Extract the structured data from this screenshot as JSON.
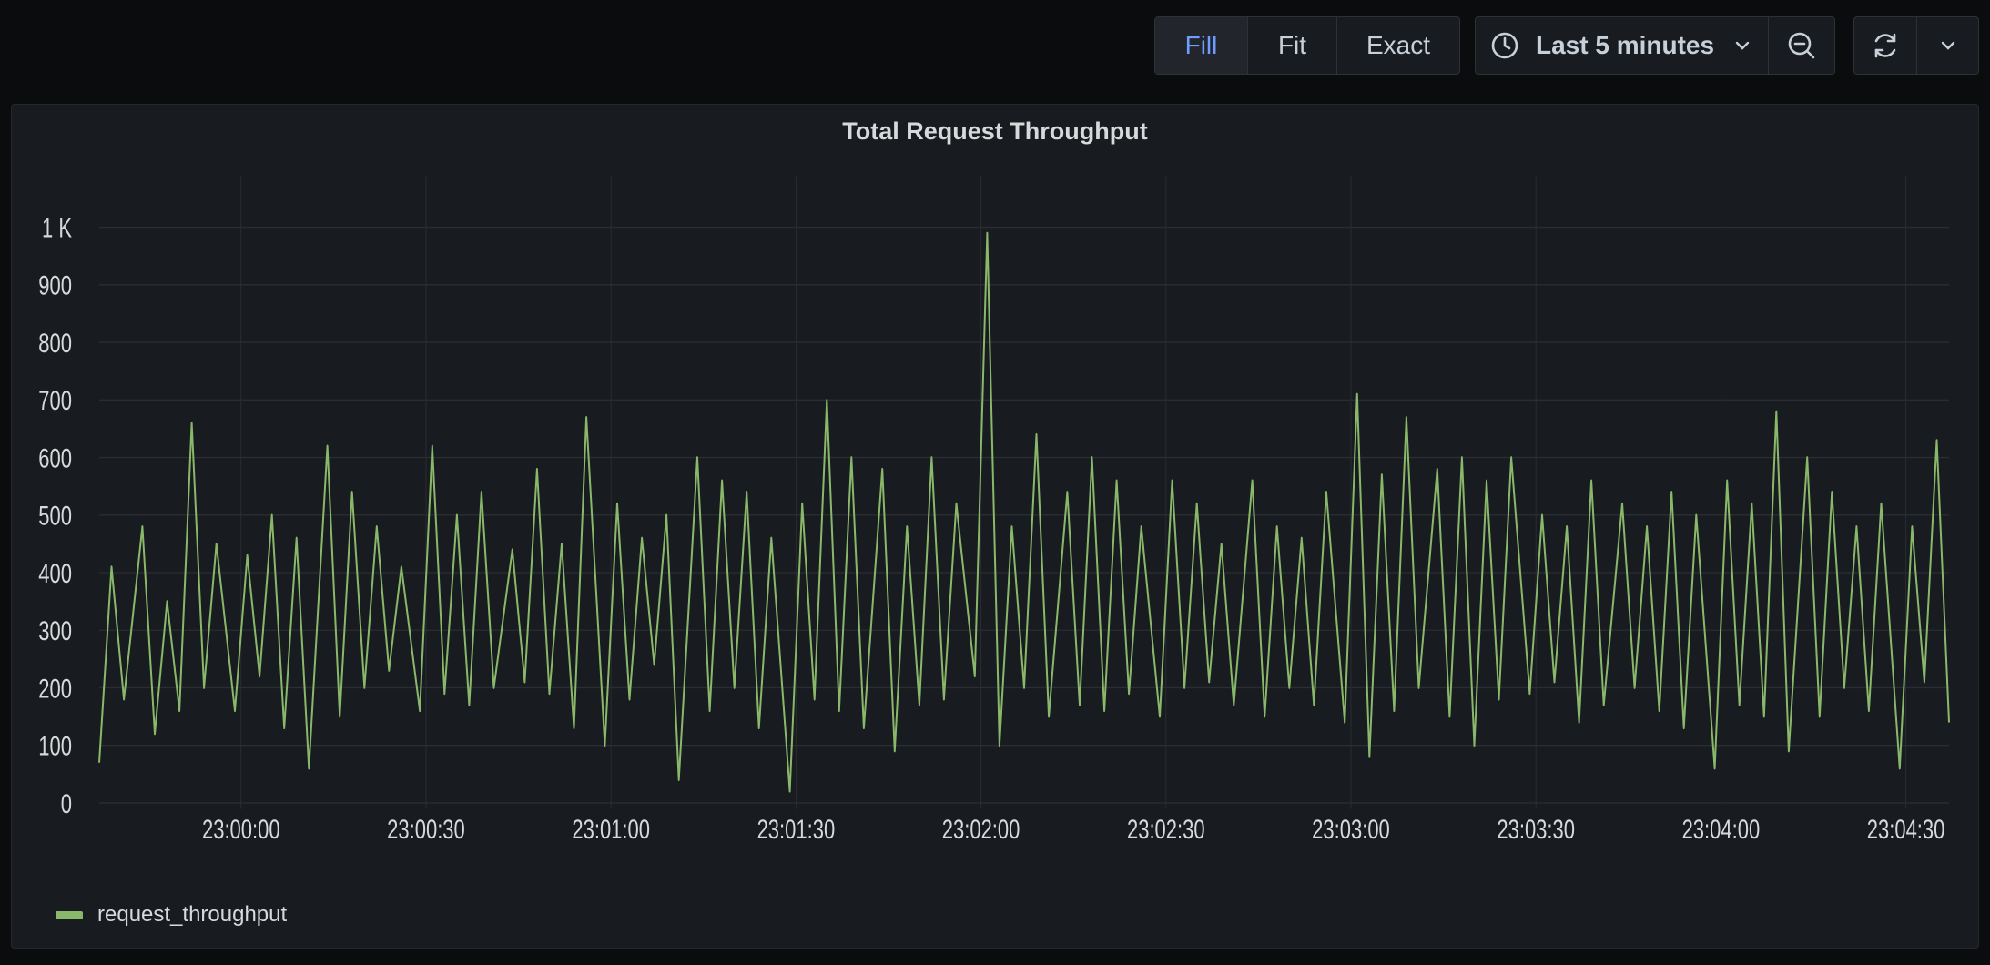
{
  "toolbar": {
    "zoom_modes": [
      {
        "label": "Fill",
        "active": true
      },
      {
        "label": "Fit",
        "active": false
      },
      {
        "label": "Exact",
        "active": false
      }
    ],
    "time_range": {
      "label": "Last 5 minutes",
      "icon": "clock-icon",
      "dropdown_icon": "chevron-down-icon"
    },
    "zoom_out_icon": "zoom-out-icon",
    "refresh_icon": "refresh-icon",
    "refresh_dropdown_icon": "chevron-down-icon"
  },
  "colors": {
    "background": "#0b0c0e",
    "panel": "#181b1f",
    "accent": "#6e9fff",
    "series": "#8ab86a",
    "grid": "#2a2d31",
    "text": "#d8d9da"
  },
  "panel": {
    "title": "Total Request Throughput"
  },
  "chart_data": {
    "type": "line",
    "title": "Total Request Throughput",
    "xlabel": "",
    "ylabel": "",
    "x_range": [
      "22:59:37",
      "23:04:37"
    ],
    "ylim": [
      0,
      1000
    ],
    "y_ticks": [
      "0",
      "100",
      "200",
      "300",
      "400",
      "500",
      "600",
      "700",
      "800",
      "900",
      "1 K"
    ],
    "x_ticks": [
      "23:00:00",
      "23:00:30",
      "23:01:00",
      "23:01:30",
      "23:02:00",
      "23:02:30",
      "23:03:00",
      "23:03:30",
      "23:04:00",
      "23:04:30"
    ],
    "grid": true,
    "legend": "bottom-left",
    "series": [
      {
        "name": "request_throughput",
        "color": "#8ab86a",
        "x": [
          "22:59:37",
          "22:59:39",
          "22:59:41",
          "22:59:44",
          "22:59:46",
          "22:59:48",
          "22:59:50",
          "22:59:52",
          "22:59:54",
          "22:59:56",
          "22:59:59",
          "23:00:01",
          "23:00:03",
          "23:00:05",
          "23:00:07",
          "23:00:09",
          "23:00:11",
          "23:00:14",
          "23:00:16",
          "23:00:18",
          "23:00:20",
          "23:00:22",
          "23:00:24",
          "23:00:26",
          "23:00:29",
          "23:00:31",
          "23:00:33",
          "23:00:35",
          "23:00:37",
          "23:00:39",
          "23:00:41",
          "23:00:44",
          "23:00:46",
          "23:00:48",
          "23:00:50",
          "23:00:52",
          "23:00:54",
          "23:00:56",
          "23:00:59",
          "23:01:01",
          "23:01:03",
          "23:01:05",
          "23:01:07",
          "23:01:09",
          "23:01:11",
          "23:01:14",
          "23:01:16",
          "23:01:18",
          "23:01:20",
          "23:01:22",
          "23:01:24",
          "23:01:26",
          "23:01:29",
          "23:01:31",
          "23:01:33",
          "23:01:35",
          "23:01:37",
          "23:01:39",
          "23:01:41",
          "23:01:44",
          "23:01:46",
          "23:01:48",
          "23:01:50",
          "23:01:52",
          "23:01:54",
          "23:01:56",
          "23:01:59",
          "23:02:01",
          "23:02:03",
          "23:02:05",
          "23:02:07",
          "23:02:09",
          "23:02:11",
          "23:02:14",
          "23:02:16",
          "23:02:18",
          "23:02:20",
          "23:02:22",
          "23:02:24",
          "23:02:26",
          "23:02:29",
          "23:02:31",
          "23:02:33",
          "23:02:35",
          "23:02:37",
          "23:02:39",
          "23:02:41",
          "23:02:44",
          "23:02:46",
          "23:02:48",
          "23:02:50",
          "23:02:52",
          "23:02:54",
          "23:02:56",
          "23:02:59",
          "23:03:01",
          "23:03:03",
          "23:03:05",
          "23:03:07",
          "23:03:09",
          "23:03:11",
          "23:03:14",
          "23:03:16",
          "23:03:18",
          "23:03:20",
          "23:03:22",
          "23:03:24",
          "23:03:26",
          "23:03:29",
          "23:03:31",
          "23:03:33",
          "23:03:35",
          "23:03:37",
          "23:03:39",
          "23:03:41",
          "23:03:44",
          "23:03:46",
          "23:03:48",
          "23:03:50",
          "23:03:52",
          "23:03:54",
          "23:03:56",
          "23:03:59",
          "23:04:01",
          "23:04:03",
          "23:04:05",
          "23:04:07",
          "23:04:09",
          "23:04:11",
          "23:04:14",
          "23:04:16",
          "23:04:18",
          "23:04:20",
          "23:04:22",
          "23:04:24",
          "23:04:26",
          "23:04:29",
          "23:04:31",
          "23:04:33",
          "23:04:35",
          "23:04:37"
        ],
        "values": [
          70,
          410,
          180,
          480,
          120,
          350,
          160,
          660,
          200,
          450,
          160,
          430,
          220,
          500,
          130,
          460,
          60,
          620,
          150,
          540,
          200,
          480,
          230,
          410,
          160,
          620,
          190,
          500,
          170,
          540,
          200,
          440,
          210,
          580,
          190,
          450,
          130,
          670,
          100,
          520,
          180,
          460,
          240,
          500,
          40,
          600,
          160,
          560,
          200,
          540,
          130,
          460,
          20,
          520,
          180,
          700,
          160,
          600,
          130,
          580,
          90,
          480,
          170,
          600,
          180,
          520,
          220,
          990,
          100,
          480,
          200,
          640,
          150,
          540,
          170,
          600,
          160,
          560,
          190,
          480,
          150,
          560,
          200,
          520,
          210,
          450,
          170,
          560,
          150,
          480,
          200,
          460,
          170,
          540,
          140,
          710,
          80,
          570,
          160,
          670,
          200,
          580,
          150,
          600,
          100,
          560,
          180,
          600,
          190,
          500,
          210,
          480,
          140,
          560,
          170,
          520,
          200,
          480,
          160,
          540,
          130,
          500,
          60,
          560,
          170,
          520,
          150,
          680,
          90,
          600,
          150,
          540,
          200,
          480,
          160,
          520,
          60,
          480,
          210,
          630,
          140
        ]
      }
    ]
  }
}
